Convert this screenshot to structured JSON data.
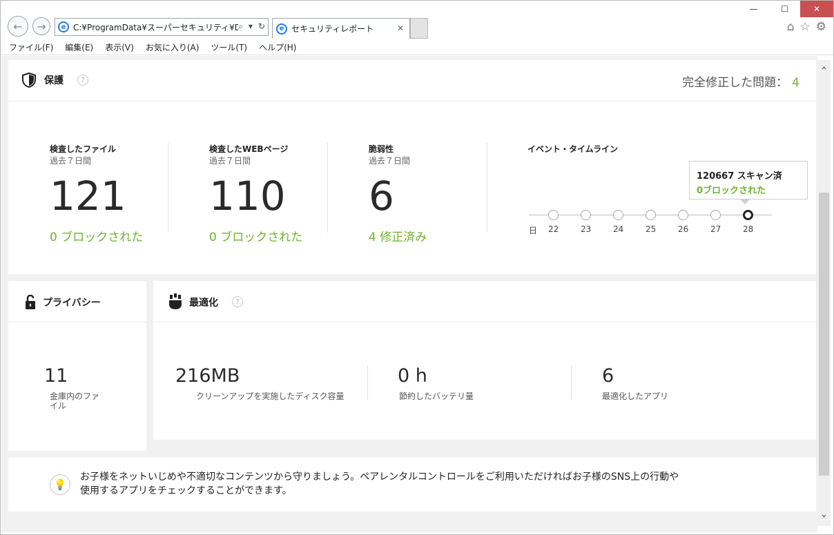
{
  "browser": {
    "address": "C:¥ProgramData¥スーパーセキュリティ¥Desk",
    "tab_title": "セキュリティレポート",
    "window_controls": [
      "—",
      "☐",
      "✕"
    ]
  },
  "menu": [
    "ファイル(F)",
    "編集(E)",
    "表示(V)",
    "お気に入り(A)",
    "ツール(T)",
    "ヘルプ(H)"
  ],
  "protection": {
    "title": "保護",
    "fixed_label": "完全修正した問題：",
    "fixed_value": "4",
    "stats": [
      {
        "title": "検査したファイル",
        "sub": "過去７日間",
        "value": "121",
        "note": "0 ブロックされた"
      },
      {
        "title": "検査したWEBページ",
        "sub": "過去７日間",
        "value": "110",
        "note": "0 ブロックされた"
      },
      {
        "title": "脆弱性",
        "sub": "過去７日間",
        "value": "6",
        "note": "4 修正済み"
      }
    ],
    "timeline": {
      "title": "イベント・タイムライン",
      "day_label": "日",
      "days": [
        "22",
        "23",
        "24",
        "25",
        "26",
        "27",
        "28"
      ],
      "active_index": 6,
      "tooltip_line1": "120667 スキャン済",
      "tooltip_line2": "0ブロックされた"
    }
  },
  "privacy": {
    "title": "プライバシー",
    "value": "11",
    "label_line1": "金庫内のファ",
    "label_line2": "イル"
  },
  "optimize": {
    "title": "最適化",
    "items": [
      {
        "value": "216MB",
        "label": "クリーンアップを実施したディスク容量"
      },
      {
        "value": "0 h",
        "label": "節約したバッテリ量"
      },
      {
        "value": "6",
        "label": "最適化したアプリ"
      }
    ]
  },
  "tip": {
    "line1": "お子様をネットいじめや不適切なコンテンツから守りましょう。ペアレンタルコントロールをご利用いただければお子様のSNS上の行動や",
    "line2": "使用するアプリをチェックすることができます。"
  }
}
